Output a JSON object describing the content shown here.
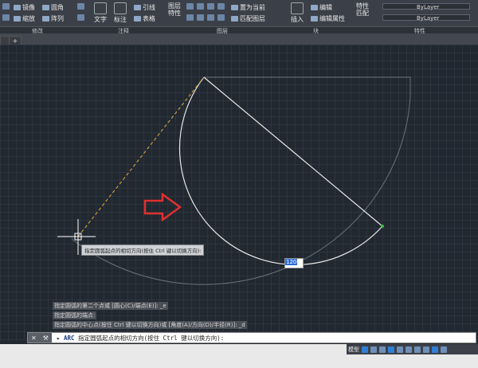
{
  "ribbon": {
    "modify": {
      "tools": [
        "镜像",
        "圆角",
        "缩放",
        "阵列"
      ],
      "panel_label": "修改"
    },
    "annotation": {
      "text_label": "文字",
      "dim_label": "标注",
      "leader_label": "引线",
      "table_label": "表格",
      "panel_label": "注释"
    },
    "layers": {
      "props_label": "图层\n特性",
      "set_current_label": "置为当前",
      "match_label": "匹配图层",
      "panel_label": "图层"
    },
    "block": {
      "insert_label": "插入",
      "edit_label": "编辑",
      "edit_attr_label": "编辑属性",
      "panel_label": "块"
    },
    "properties": {
      "match_label": "特性\n匹配",
      "layer_combo_1": "ByLayer",
      "layer_combo_2": "ByLayer",
      "panel_label": "特性"
    }
  },
  "canvas": {
    "tooltip": "指定圆弧起点的相切方向(按住 Ctrl 键以切换方向):",
    "dynamic_input_value": "120"
  },
  "history": [
    "指定圆弧的第二个点或 [圆心(C)/端点(E)]: _e",
    "指定圆弧的端点:",
    "指定圆弧的中心点(按住 Ctrl 键以切换方向)或 [角度(A)/方向(D)/半径(R)]: _d"
  ],
  "command": {
    "name": "ARC",
    "prompt": "指定圆弧起点的相切方向(按住 Ctrl 键以切换方向):"
  },
  "status": {
    "model_label": "模型"
  },
  "colors": {
    "canvas": "#212830",
    "arrow": "#e03030",
    "drawing": "#e8e8e8",
    "tangent": "#c89a3c"
  }
}
